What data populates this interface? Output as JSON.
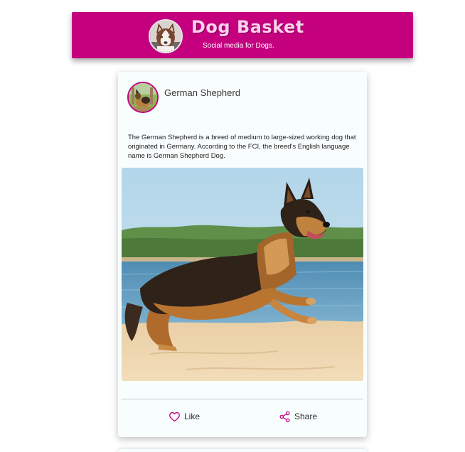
{
  "header": {
    "title": "Dog Basket",
    "tagline": "Social media for Dogs.",
    "brand_color": "#c4007f",
    "logo_icon": "husky-avatar"
  },
  "post": {
    "author": "German Shepherd",
    "avatar_icon": "german-shepherd-avatar",
    "body": "The German Shepherd is a breed of medium to large-sized working dog that originated in Germany. According to the FCI, the breed's English language name is German Shepherd Dog.",
    "image_icon": "german-shepherd-running-on-beach-photo",
    "actions": {
      "like_label": "Like",
      "share_label": "Share"
    }
  }
}
